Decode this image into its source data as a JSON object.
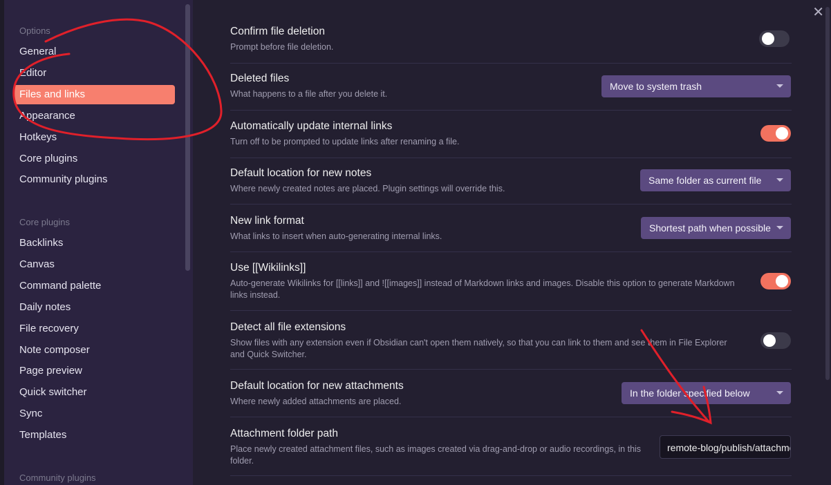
{
  "window": {
    "close_icon": "close-icon"
  },
  "sidebar": {
    "options_heading": "Options",
    "options": [
      {
        "label": "General"
      },
      {
        "label": "Editor"
      },
      {
        "label": "Files and links",
        "active": true
      },
      {
        "label": "Appearance"
      },
      {
        "label": "Hotkeys"
      },
      {
        "label": "Core plugins"
      },
      {
        "label": "Community plugins"
      }
    ],
    "core_heading": "Core plugins",
    "core": [
      {
        "label": "Backlinks"
      },
      {
        "label": "Canvas"
      },
      {
        "label": "Command palette"
      },
      {
        "label": "Daily notes"
      },
      {
        "label": "File recovery"
      },
      {
        "label": "Note composer"
      },
      {
        "label": "Page preview"
      },
      {
        "label": "Quick switcher"
      },
      {
        "label": "Sync"
      },
      {
        "label": "Templates"
      }
    ],
    "community_heading": "Community plugins"
  },
  "settings": [
    {
      "name": "Confirm file deletion",
      "desc": "Prompt before file deletion.",
      "control": "toggle",
      "enabled": true
    },
    {
      "name": "Deleted files",
      "desc": "What happens to a file after you delete it.",
      "control": "dropdown",
      "value": "Move to system trash"
    },
    {
      "name": "Automatically update internal links",
      "desc": "Turn off to be prompted to update links after renaming a file.",
      "control": "toggle",
      "enabled": true
    },
    {
      "name": "Default location for new notes",
      "desc": "Where newly created notes are placed. Plugin settings will override this.",
      "control": "dropdown",
      "value": "Same folder as current file"
    },
    {
      "name": "New link format",
      "desc": "What links to insert when auto-generating internal links.",
      "control": "dropdown",
      "value": "Shortest path when possible"
    },
    {
      "name": "Use [[Wikilinks]]",
      "desc": "Auto-generate Wikilinks for [[links]] and ![[images]] instead of Markdown links and images. Disable this option to generate Markdown links instead.",
      "control": "toggle",
      "enabled": true
    },
    {
      "name": "Detect all file extensions",
      "desc": "Show files with any extension even if Obsidian can't open them natively, so that you can link to them and see them in File Explorer and Quick Switcher.",
      "control": "toggle",
      "enabled": false
    },
    {
      "name": "Default location for new attachments",
      "desc": "Where newly added attachments are placed.",
      "control": "dropdown",
      "value": "In the folder specified below"
    },
    {
      "name": "Attachment folder path",
      "desc": "Place newly created attachment files, such as images created via drag-and-drop or audio recordings, in this folder.",
      "control": "text",
      "value": "remote-blog/publish/attachments"
    }
  ],
  "colors": {
    "accent": "#f77f6e",
    "dropdown_bg": "#5b4a80",
    "annotation": "#e0202a"
  }
}
